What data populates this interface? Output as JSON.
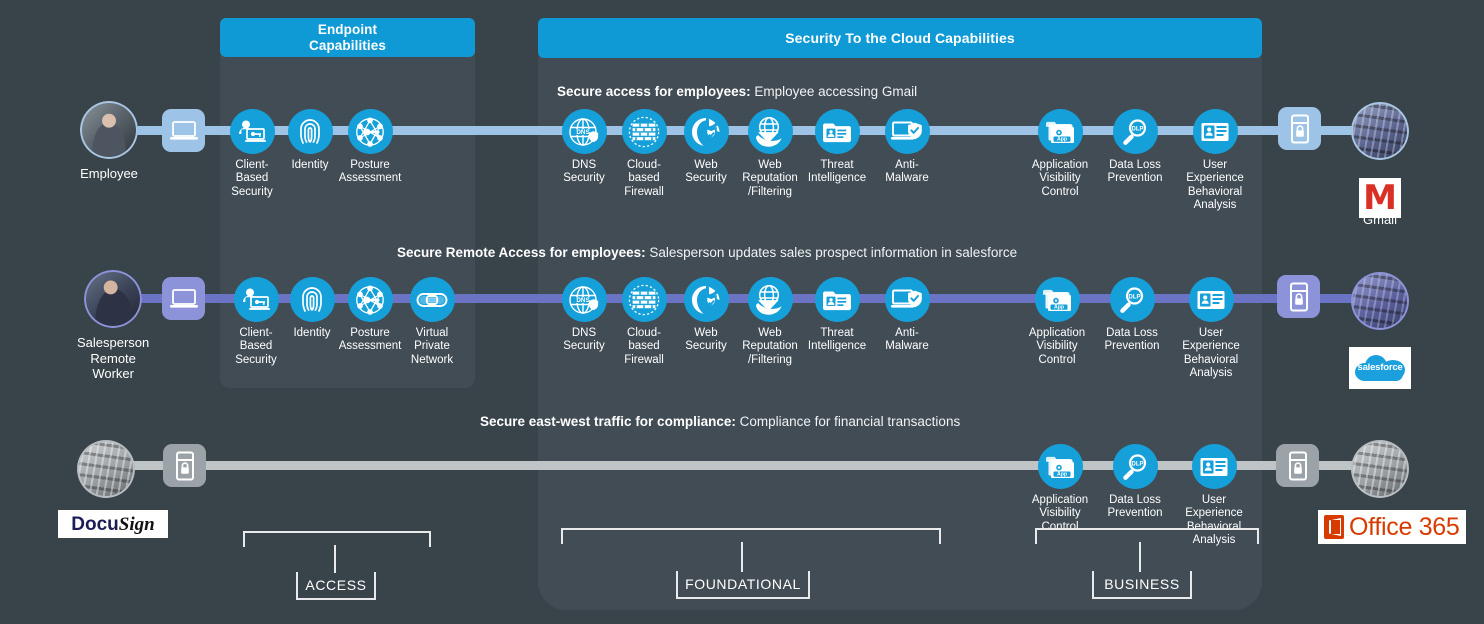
{
  "headers": {
    "endpoint": "Endpoint\nCapabilities",
    "cloud": "Security To the Cloud Capabilities"
  },
  "colors": {
    "background": "#39434a",
    "panel": "#414c54",
    "header_blue": "#0f9ad6",
    "icon_blue": "#16a0da",
    "wire_blue": "#9dc3e6",
    "wire_purple": "#6b74c4",
    "wire_gray": "#bfc4c7",
    "gmail_red": "#d93025",
    "salesforce_blue": "#1ca0dd",
    "office_orange": "#d83b01",
    "docusign_navy": "#1d1d56"
  },
  "rows": [
    {
      "id": "row-employee",
      "title_bold": "Secure access for employees:",
      "title_rest": " Employee accessing Gmail",
      "actor_label": "Employee",
      "actor_icon": "employee-photo",
      "device_icon": "laptop-icon",
      "endpoint_caps": [
        {
          "label": "Client-\nBased\nSecurity",
          "icon": "client-based-security-icon"
        },
        {
          "label": "Identity",
          "icon": "fingerprint-identity-icon"
        },
        {
          "label": "Posture\nAssessment",
          "icon": "posture-assessment-icon"
        }
      ],
      "cloud_caps_foundational": [
        {
          "label": "DNS\nSecurity",
          "icon": "dns-security-icon"
        },
        {
          "label": "Cloud-\nbased\nFirewall",
          "icon": "cloud-firewall-icon"
        },
        {
          "label": "Web\nSecurity",
          "icon": "web-security-icon"
        },
        {
          "label": "Web\nReputation\n/Filtering",
          "icon": "web-reputation-filtering-icon"
        },
        {
          "label": "Threat\nIntelligence",
          "icon": "threat-intelligence-icon"
        },
        {
          "label": "Anti-\nMalware",
          "icon": "anti-malware-icon"
        }
      ],
      "cloud_caps_business": [
        {
          "label": "Application\nVisibility\nControl",
          "icon": "application-visibility-control-icon"
        },
        {
          "label": "Data Loss\nPrevention",
          "icon": "data-loss-prevention-icon"
        },
        {
          "label": "User Experience\nBehavioral\nAnalysis",
          "icon": "user-experience-behavioral-analysis-icon"
        }
      ],
      "destination_secure_icon": "secure-server-lock-icon",
      "destination_server_icon": "datacenter-photo",
      "destination_logo": "Gmail",
      "destination_logo_icon": "gmail-logo"
    },
    {
      "id": "row-salesperson",
      "title_bold": "Secure Remote Access for employees:",
      "title_rest": " Salesperson updates sales prospect information in salesforce",
      "actor_label": "Salesperson\nRemote\nWorker",
      "actor_icon": "salesperson-photo",
      "device_icon": "laptop-icon",
      "endpoint_caps": [
        {
          "label": "Client-\nBased\nSecurity",
          "icon": "client-based-security-icon"
        },
        {
          "label": "Identity",
          "icon": "fingerprint-identity-icon"
        },
        {
          "label": "Posture\nAssessment",
          "icon": "posture-assessment-icon"
        },
        {
          "label": "Virtual\nPrivate\nNetwork",
          "icon": "virtual-private-network-icon"
        }
      ],
      "cloud_caps_foundational": [
        {
          "label": "DNS\nSecurity",
          "icon": "dns-security-icon"
        },
        {
          "label": "Cloud-\nbased\nFirewall",
          "icon": "cloud-firewall-icon"
        },
        {
          "label": "Web\nSecurity",
          "icon": "web-security-icon"
        },
        {
          "label": "Web\nReputation\n/Filtering",
          "icon": "web-reputation-filtering-icon"
        },
        {
          "label": "Threat\nIntelligence",
          "icon": "threat-intelligence-icon"
        },
        {
          "label": "Anti-\nMalware",
          "icon": "anti-malware-icon"
        }
      ],
      "cloud_caps_business": [
        {
          "label": "Application\nVisibility\nControl",
          "icon": "application-visibility-control-icon"
        },
        {
          "label": "Data Loss\nPrevention",
          "icon": "data-loss-prevention-icon"
        },
        {
          "label": "User Experience\nBehavioral\nAnalysis",
          "icon": "user-experience-behavioral-analysis-icon"
        }
      ],
      "destination_secure_icon": "secure-server-lock-icon",
      "destination_server_icon": "datacenter-photo",
      "destination_logo": "salesforce",
      "destination_logo_icon": "salesforce-logo"
    },
    {
      "id": "row-compliance",
      "title_bold": "Secure east-west traffic for compliance:",
      "title_rest": " Compliance for financial transactions",
      "actor_label": "",
      "actor_icon": "datacenter-photo",
      "device_icon": "secure-server-lock-icon",
      "endpoint_caps": [],
      "cloud_caps_foundational": [],
      "cloud_caps_business": [
        {
          "label": "Application\nVisibility\nControl",
          "icon": "application-visibility-control-icon"
        },
        {
          "label": "Data Loss\nPrevention",
          "icon": "data-loss-prevention-icon"
        },
        {
          "label": "User Experience\nBehavioral\nAnalysis",
          "icon": "user-experience-behavioral-analysis-icon"
        }
      ],
      "destination_secure_icon": "secure-server-lock-icon",
      "destination_server_icon": "datacenter-photo",
      "source_logo": "DocuSign",
      "source_logo_icon": "docusign-logo",
      "destination_logo": "Office 365",
      "destination_logo_icon": "office365-logo"
    }
  ],
  "brackets": [
    {
      "id": "bracket-access",
      "label": "ACCESS"
    },
    {
      "id": "bracket-foundational",
      "label": "FOUNDATIONAL"
    },
    {
      "id": "bracket-business",
      "label": "BUSINESS"
    }
  ],
  "logos": {
    "docusign_docu": "Docu",
    "docusign_sign": "Sign",
    "office365": "Office 365",
    "salesforce": "salesforce",
    "gmail_glyph": "M"
  }
}
